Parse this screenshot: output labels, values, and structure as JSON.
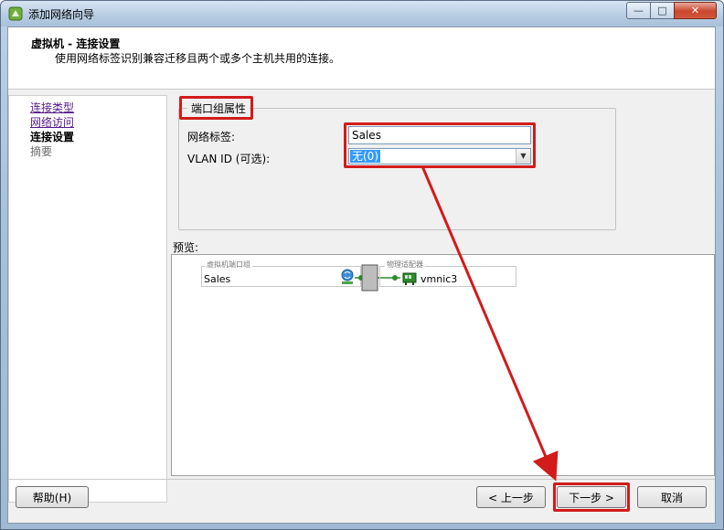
{
  "window": {
    "title": "添加网络向导",
    "minimize_symbol": "—",
    "maximize_symbol": "□",
    "close_symbol": "✕"
  },
  "header": {
    "title": "虚拟机 - 连接设置",
    "subtitle": "使用网络标签识别兼容迁移且两个或多个主机共用的连接。"
  },
  "nav": {
    "items": [
      {
        "label": "连接类型",
        "state": "visited"
      },
      {
        "label": "网络访问",
        "state": "visited"
      },
      {
        "label": "连接设置",
        "state": "current"
      },
      {
        "label": "摘要",
        "state": "disabled"
      }
    ]
  },
  "port_group": {
    "section_title": "端口组属性",
    "network_label_caption": "网络标签:",
    "network_label_value": "Sales",
    "vlan_caption": "VLAN ID (可选):",
    "vlan_value": "无(0)"
  },
  "preview": {
    "caption": "预览:",
    "port_group_legend": "虚拟机端口组",
    "port_group_name": "Sales",
    "adapter_legend": "物理适配器",
    "adapter_name": "vmnic3"
  },
  "buttons": {
    "help": "帮助(H)",
    "back": "< 上一步",
    "next": "下一步 >",
    "cancel": "取消"
  },
  "colors": {
    "highlight_red": "#d21b1b",
    "selection_blue": "#3399ff",
    "visited_link": "#551a8b",
    "nic_green": "#2e8b2e"
  }
}
